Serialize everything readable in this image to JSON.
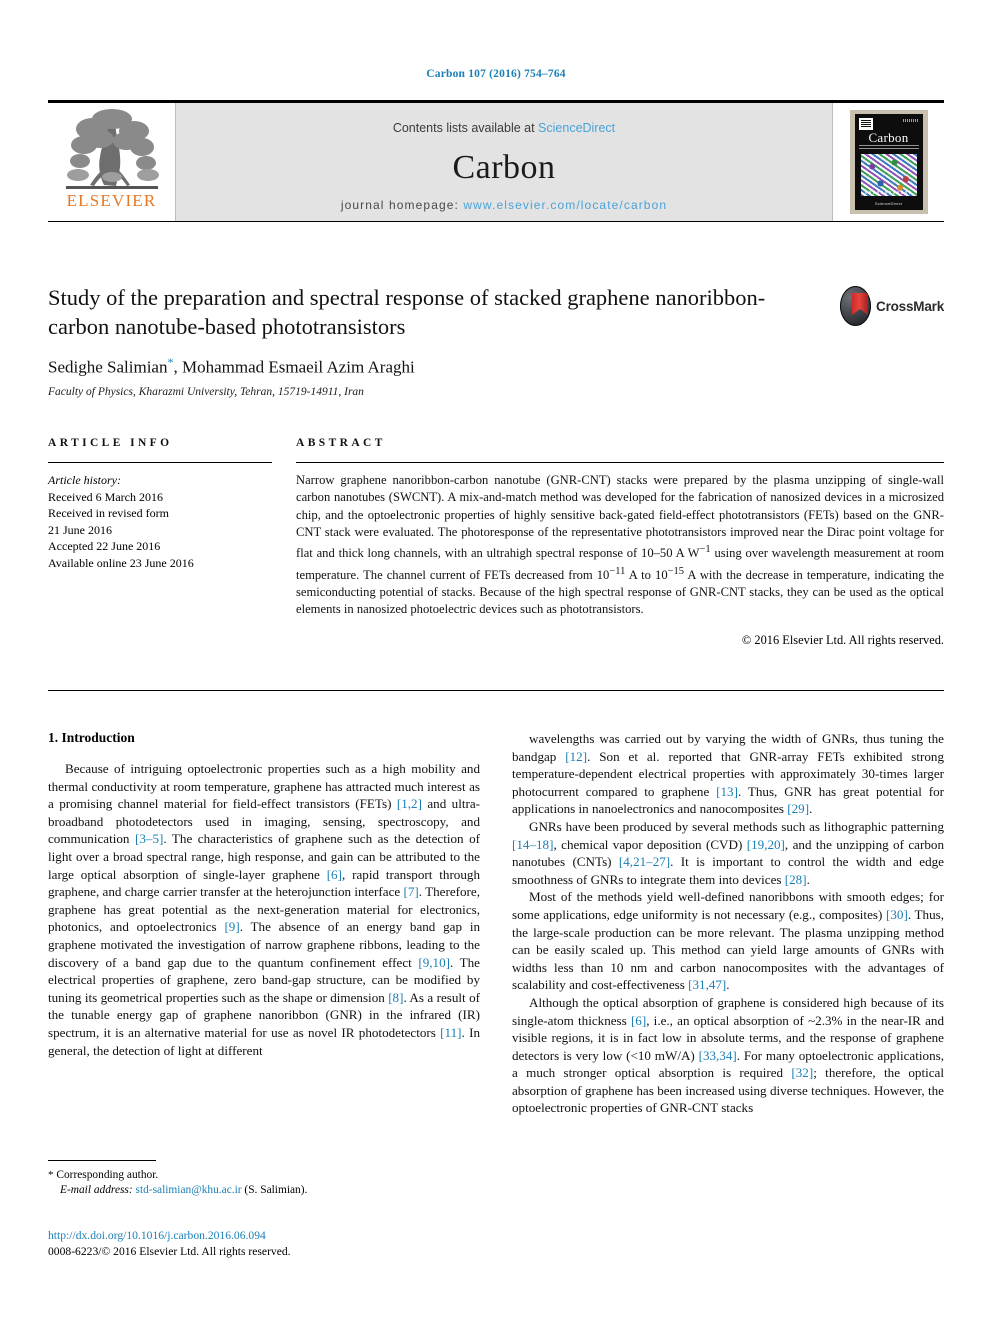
{
  "running_head": "Carbon 107 (2016) 754–764",
  "masthead": {
    "publisher_name": "ELSEVIER",
    "contents_prefix": "Contents lists available at ",
    "contents_link": "ScienceDirect",
    "journal_title": "Carbon",
    "homepage_prefix": "journal homepage: ",
    "homepage_url": "www.elsevier.com/locate/carbon",
    "cover_journal_name": "Carbon"
  },
  "article": {
    "title": "Study of the preparation and spectral response of stacked graphene nanoribbon-carbon nanotube-based phototransistors",
    "authors": "Sedighe Salimian",
    "authors_rest": ", Mohammad Esmaeil Azim Araghi",
    "corresponding_marker": "*",
    "affiliation": "Faculty of Physics, Kharazmi University, Tehran, 15719-14911, Iran",
    "crossmark_label": "CrossMark"
  },
  "article_info": {
    "heading": "ARTICLE INFO",
    "history_label": "Article history:",
    "history": [
      "Received 6 March 2016",
      "Received in revised form",
      "21 June 2016",
      "Accepted 22 June 2016",
      "Available online 23 June 2016"
    ]
  },
  "abstract": {
    "heading": "ABSTRACT",
    "text": "Narrow graphene nanoribbon-carbon nanotube (GNR-CNT) stacks were prepared by the plasma unzipping of single-wall carbon nanotubes (SWCNT). A mix-and-match method was developed for the fabrication of nanosized devices in a microsized chip, and the optoelectronic properties of highly sensitive back-gated field-effect phototransistors (FETs) based on the GNR-CNT stack were evaluated. The photoresponse of the representative phototransistors improved near the Dirac point voltage for flat and thick long channels, with an ultrahigh spectral response of 10–50 A W−1 using over wavelength measurement at room temperature. The channel current of FETs decreased from 10−11 A to 10−15 A with the decrease in temperature, indicating the semiconducting potential of stacks. Because of the high spectral response of GNR-CNT stacks, they can be used as the optical elements in nanosized photoelectric devices such as phototransistors.",
    "copyright": "© 2016 Elsevier Ltd. All rights reserved."
  },
  "body": {
    "section_heading": "1. Introduction",
    "left_paragraphs": [
      "Because of intriguing optoelectronic properties such as a high mobility and thermal conductivity at room temperature, graphene has attracted much interest as a promising channel material for field-effect transistors (FETs) [1,2] and ultra-broadband photodetectors used in imaging, sensing, spectroscopy, and communication [3–5]. The characteristics of graphene such as the detection of light over a broad spectral range, high response, and gain can be attributed to the large optical absorption of single-layer graphene [6], rapid transport through graphene, and charge carrier transfer at the heterojunction interface [7]. Therefore, graphene has great potential as the next-generation material for electronics, photonics, and optoelectronics [9]. The absence of an energy band gap in graphene motivated the investigation of narrow graphene ribbons, leading to the discovery of a band gap due to the quantum confinement effect [9,10]. The electrical properties of graphene, zero band-gap structure, can be modified by tuning its geometrical properties such as the shape or dimension [8]. As a result of the tunable energy gap of graphene nanoribbon (GNR) in the infrared (IR) spectrum, it is an alternative material for use as novel IR photodetectors [11]. In general, the detection of light at different"
    ],
    "right_paragraphs": [
      "wavelengths was carried out by varying the width of GNRs, thus tuning the bandgap [12]. Son et al. reported that GNR-array FETs exhibited strong temperature-dependent electrical properties with approximately 30-times larger photocurrent compared to graphene [13]. Thus, GNR has great potential for applications in nanoelectronics and nanocomposites [29].",
      "GNRs have been produced by several methods such as lithographic patterning [14–18], chemical vapor deposition (CVD) [19,20], and the unzipping of carbon nanotubes (CNTs) [4,21–27]. It is important to control the width and edge smoothness of GNRs to integrate them into devices [28].",
      "Most of the methods yield well-defined nanoribbons with smooth edges; for some applications, edge uniformity is not necessary (e.g., composites) [30]. Thus, the large-scale production can be more relevant. The plasma unzipping method can be easily scaled up. This method can yield large amounts of GNRs with widths less than 10 nm and carbon nanocomposites with the advantages of scalability and cost-effectiveness [31,47].",
      "Although the optical absorption of graphene is considered high because of its single-atom thickness [6], i.e., an optical absorption of ~2.3% in the near-IR and visible regions, it is in fact low in absolute terms, and the response of graphene detectors is very low (<10 mW/A) [33,34]. For many optoelectronic applications, a much stronger optical absorption is required [32]; therefore, the optical absorption of graphene has been increased using diverse techniques. However, the optoelectronic properties of GNR-CNT stacks"
    ]
  },
  "footnote": {
    "corresponding_author": "Corresponding author.",
    "email_label": "E-mail address:",
    "email": "std-salimian@khu.ac.ir",
    "email_suffix": "(S. Salimian)."
  },
  "footer": {
    "doi": "http://dx.doi.org/10.1016/j.carbon.2016.06.094",
    "issn_line": "0008-6223/© 2016 Elsevier Ltd. All rights reserved."
  },
  "colors": {
    "link_blue": "#1a7fb5",
    "light_blue": "#4aa3d8",
    "elsevier_orange": "#e87722",
    "masthead_grey": "#e3e3e3"
  }
}
